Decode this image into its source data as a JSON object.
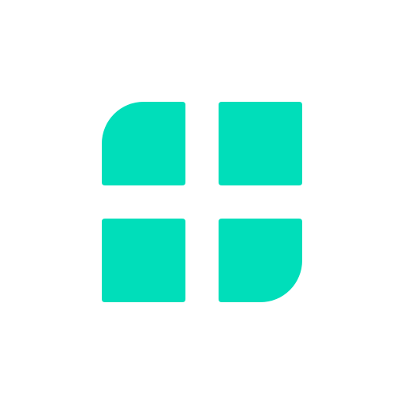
{
  "logo": {
    "icon_name": "four-tile-grid-icon",
    "tile_color": "#00DEBA",
    "background_color": "#FFFFFF",
    "tiles": [
      {
        "name": "top-left",
        "rounded_corner": "top-left"
      },
      {
        "name": "top-right",
        "rounded_corner": "none"
      },
      {
        "name": "bottom-left",
        "rounded_corner": "none"
      },
      {
        "name": "bottom-right",
        "rounded_corner": "bottom-right"
      }
    ]
  }
}
